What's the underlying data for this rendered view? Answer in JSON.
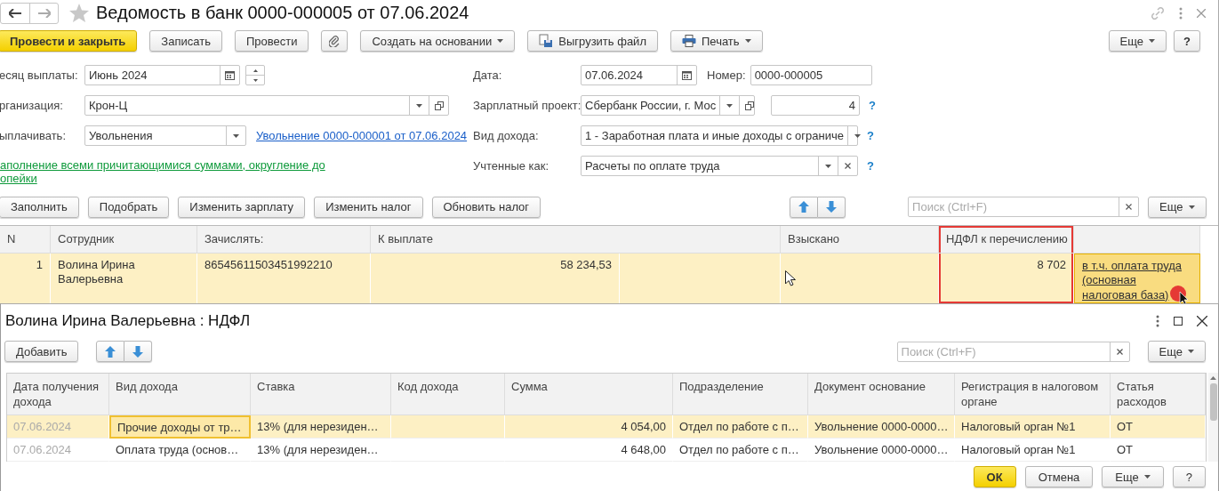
{
  "window": {
    "title": "Ведомость в банк 0000-000005 от 07.06.2024"
  },
  "toolbar": {
    "buttons": [
      {
        "label": "Провести и закрыть",
        "kind": "primary"
      },
      {
        "label": "Записать",
        "kind": "plain"
      },
      {
        "label": "Провести",
        "kind": "plain"
      },
      {
        "kind": "attach"
      },
      {
        "label": "Создать на основании",
        "kind": "menu"
      },
      {
        "label": "Выгрузить файл",
        "kind": "export"
      },
      {
        "label": "Печать",
        "kind": "print"
      }
    ],
    "more": "Еще",
    "help": "?"
  },
  "fields_left": [
    {
      "label": "есяц выплаты:",
      "value": "Июнь 2024",
      "kind": "month"
    },
    {
      "label": "рганизация:",
      "value": "Крон-Ц",
      "kind": "catalog"
    },
    {
      "label": "ыплачивать:",
      "value": "Увольнения",
      "kind": "choice",
      "link": "Увольнение 0000-000001 от 07.06.2024"
    }
  ],
  "fill_note": [
    "аполнение всеми причитающимися суммами, округление до",
    "опейки"
  ],
  "fields_right": [
    {
      "label": "Дата:",
      "value": "07.06.2024",
      "kind": "date",
      "extra_label": "Номер:",
      "extra_value": "0000-000005"
    },
    {
      "label": "Зарплатный проект:",
      "value": "Сбербанк России, г. Мос",
      "kind": "catalog",
      "extra_value": "4",
      "help": "?"
    },
    {
      "label": "Вид дохода:",
      "value": "1 - Заработная плата и иные доходы с ограниче",
      "kind": "choice",
      "help": "?"
    },
    {
      "label": "Учтенные как:",
      "value": "Расчеты по оплате труда",
      "kind": "clearable",
      "help": "?"
    }
  ],
  "table_toolbar": {
    "buttons": [
      "Заполнить",
      "Подобрать",
      "Изменить зарплату",
      "Изменить налог",
      "Обновить налог"
    ],
    "search_placeholder": "Поиск (Ctrl+F)",
    "more": "Еще"
  },
  "table": {
    "columns": [
      {
        "title": "N"
      },
      {
        "title": "Сотрудник"
      },
      {
        "title": "Зачислять:"
      },
      {
        "title": "К выплате",
        "kind": "double"
      },
      {
        "title": "Взыскано"
      },
      {
        "title": "НДФЛ к перечислению",
        "highlighted": true
      },
      {
        "kind": "blank"
      }
    ],
    "rows": [
      {
        "selected": true,
        "cells": [
          {
            "text": "1",
            "kind": "number"
          },
          {
            "text": "Волина Ирина Валерьевна"
          },
          {
            "text": "86545611503451992210"
          },
          {
            "text": "58 234,53",
            "kind": "number"
          },
          {},
          {},
          {
            "text": "8 702",
            "kind": "number"
          },
          {
            "text": "в т.ч. оплата труда (основная налоговая база)",
            "kind": "link",
            "focused": true
          }
        ]
      }
    ]
  },
  "dialog": {
    "title": "Волина Ирина Валерьевна : НДФЛ",
    "add": "Добавить",
    "search_placeholder": "Поиск (Ctrl+F)",
    "more": "Еще",
    "columns": [
      {
        "title": "Дата получения дохода",
        "disabled": true
      },
      {
        "title": "Вид дохода"
      },
      {
        "title": "Ставка"
      },
      {
        "title": "Код дохода"
      },
      {
        "title": "Сумма"
      },
      {
        "title": "Подразделение"
      },
      {
        "title": "Документ основание"
      },
      {
        "title": "Регистрация в налоговом органе"
      },
      {
        "title": "Статья расходов"
      }
    ],
    "rows": [
      {
        "selected": true,
        "cells": [
          {
            "text": "07.06.2024"
          },
          {
            "text": "Прочие доходы от тр…",
            "focused": true
          },
          {
            "text": "13% (для нерезиден…"
          },
          {},
          {
            "text": "4 054,00",
            "kind": "number"
          },
          {
            "text": "Отдел по работе с п…"
          },
          {
            "text": "Увольнение 0000-0000…"
          },
          {
            "text": "Налоговый орган №1"
          },
          {
            "text": "ОТ"
          }
        ]
      },
      {
        "selected": false,
        "cells": [
          {
            "text": "07.06.2024"
          },
          {
            "text": "Оплата труда (основ…"
          },
          {
            "text": "13% (для нерезиден…"
          },
          {},
          {
            "text": "4 648,00",
            "kind": "number"
          },
          {
            "text": "Отдел по работе с п…"
          },
          {
            "text": "Увольнение 0000-0000…"
          },
          {
            "text": "Налоговый орган №1"
          },
          {
            "text": "ОТ"
          }
        ]
      }
    ],
    "footer": [
      {
        "label": "ОК",
        "kind": "primary"
      },
      {
        "label": "Отмена",
        "kind": "plain"
      },
      {
        "label": "Еще",
        "kind": "menu"
      },
      {
        "label": "?",
        "kind": "plain"
      }
    ]
  }
}
